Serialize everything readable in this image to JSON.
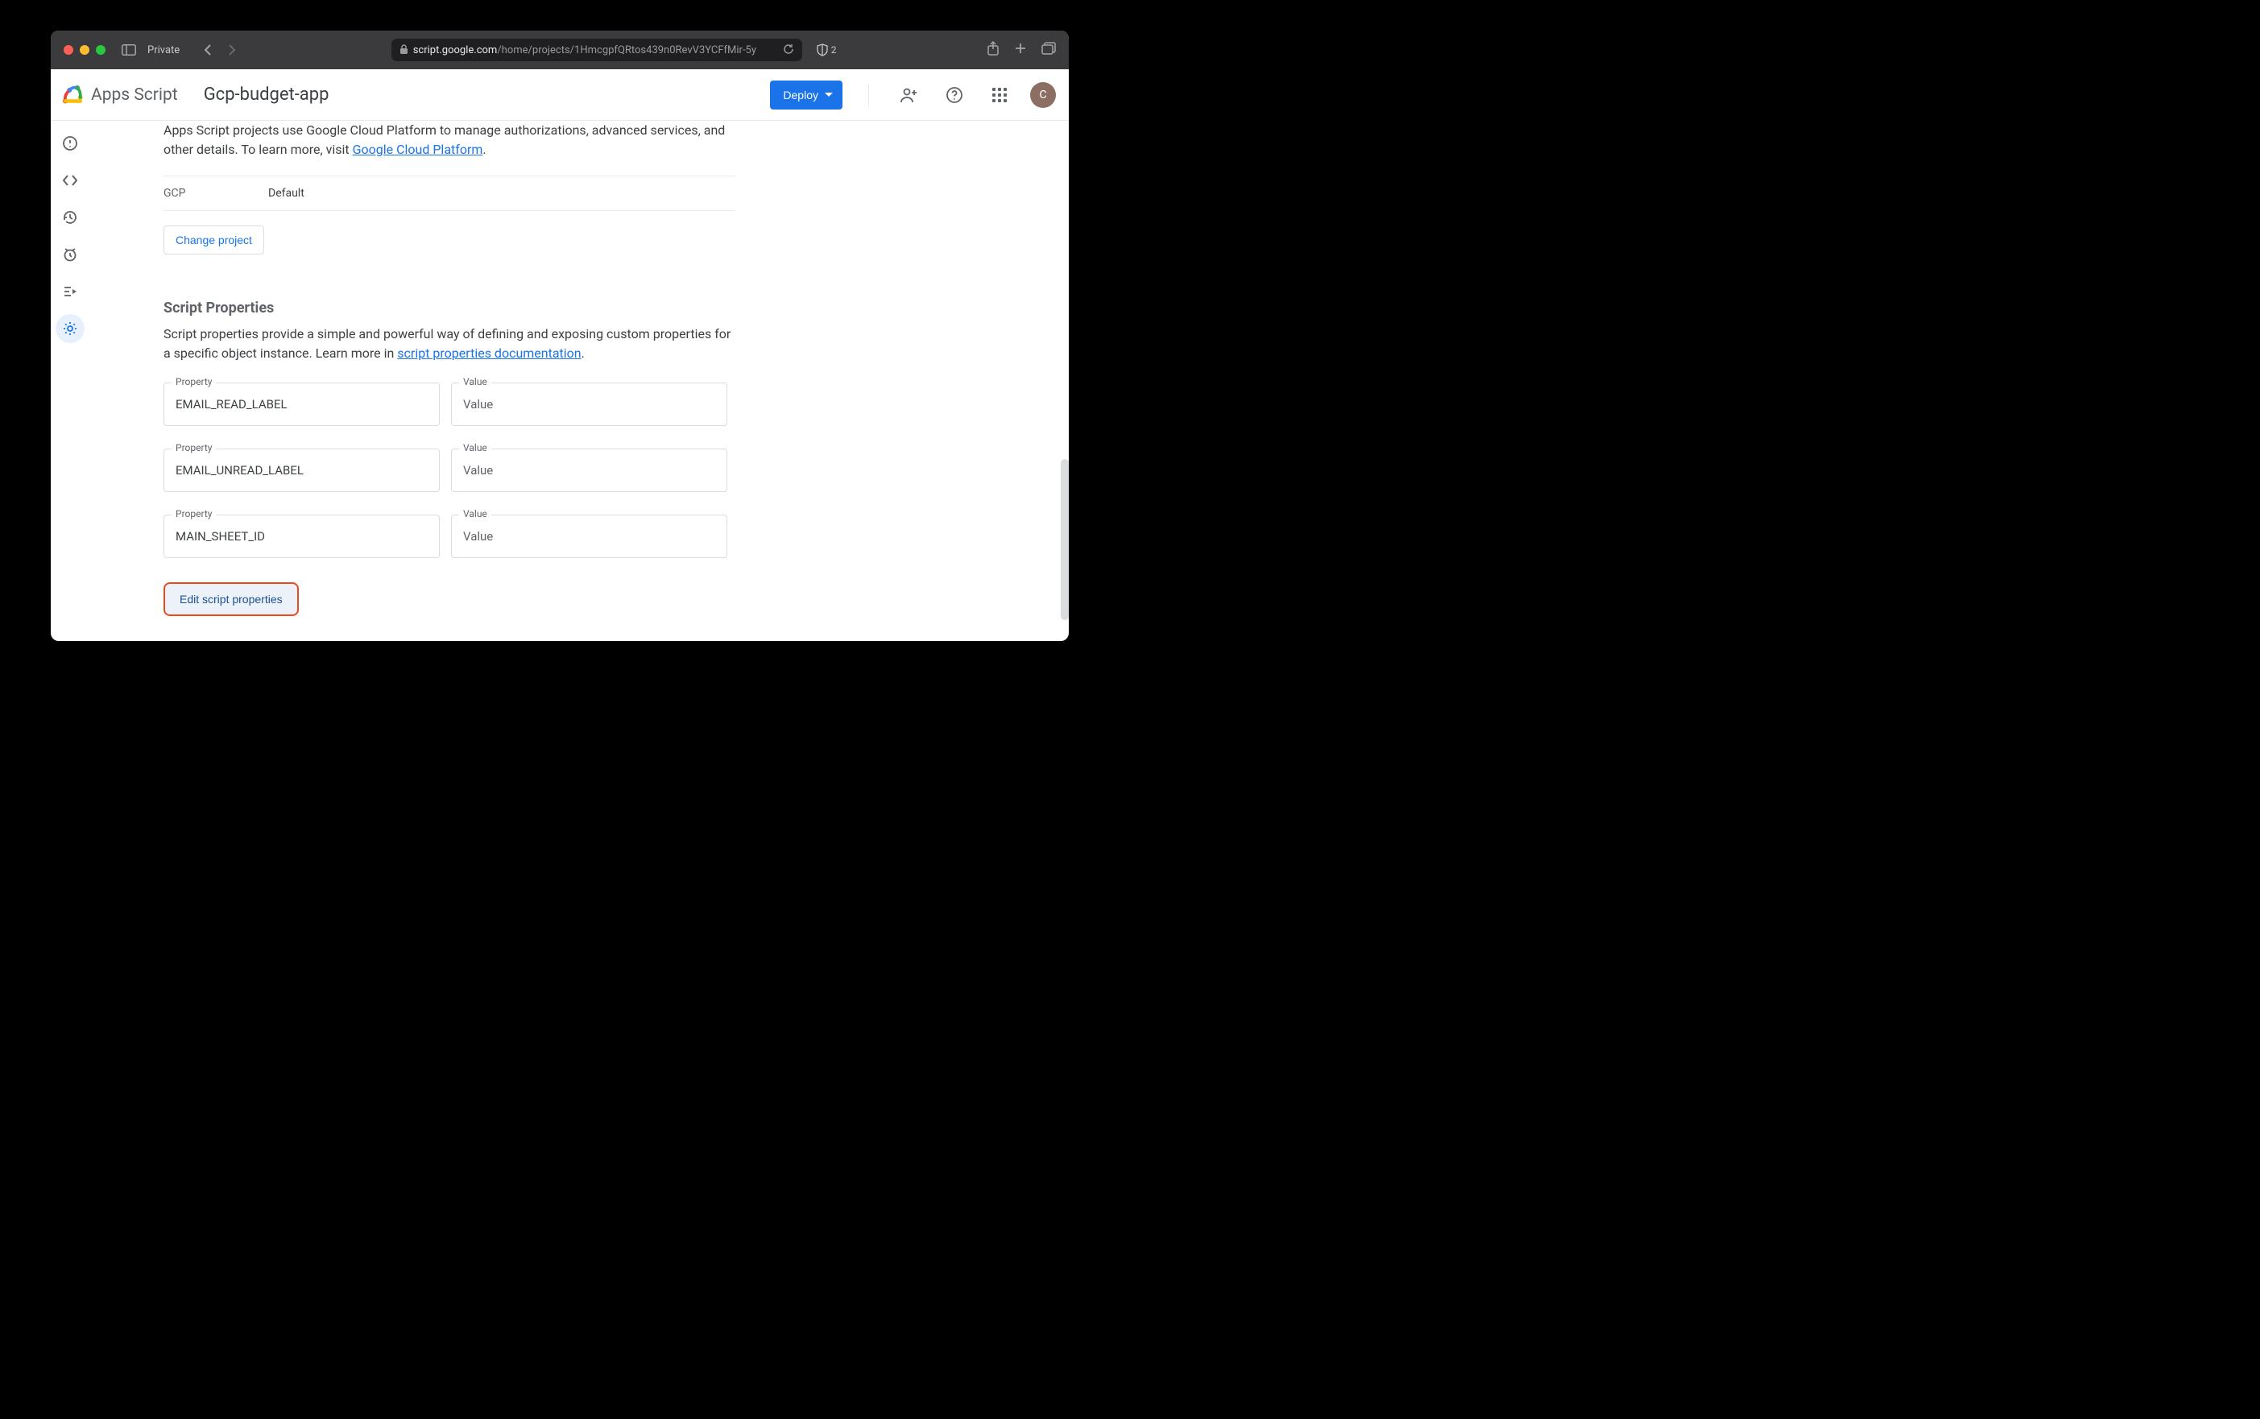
{
  "browser": {
    "private_label": "Private",
    "url_domain": "script.google.com",
    "url_path": "/home/projects/1HmcgpfQRtos439n0RevV3YCFfMir-5y",
    "shield_count": "2"
  },
  "header": {
    "product": "Apps Script",
    "project": "Gcp-budget-app",
    "deploy_label": "Deploy",
    "avatar_letter": "C"
  },
  "gcp_section": {
    "desc_prefix": "Apps Script projects use Google Cloud Platform to manage authorizations, advanced services, and other details. To learn more, visit ",
    "desc_link": "Google Cloud Platform",
    "desc_suffix": ".",
    "row_label": "GCP",
    "row_value": "Default",
    "change_project_label": "Change project"
  },
  "script_props": {
    "heading": "Script Properties",
    "desc_prefix": "Script properties provide a simple and powerful way of defining and exposing custom properties for a specific object instance. Learn more in ",
    "desc_link": "script properties documentation",
    "desc_suffix": ".",
    "property_legend": "Property",
    "value_legend": "Value",
    "value_placeholder": "Value",
    "rows": [
      {
        "property": "EMAIL_READ_LABEL",
        "value": ""
      },
      {
        "property": "EMAIL_UNREAD_LABEL",
        "value": ""
      },
      {
        "property": "MAIN_SHEET_ID",
        "value": ""
      }
    ],
    "edit_button_label": "Edit script properties"
  }
}
